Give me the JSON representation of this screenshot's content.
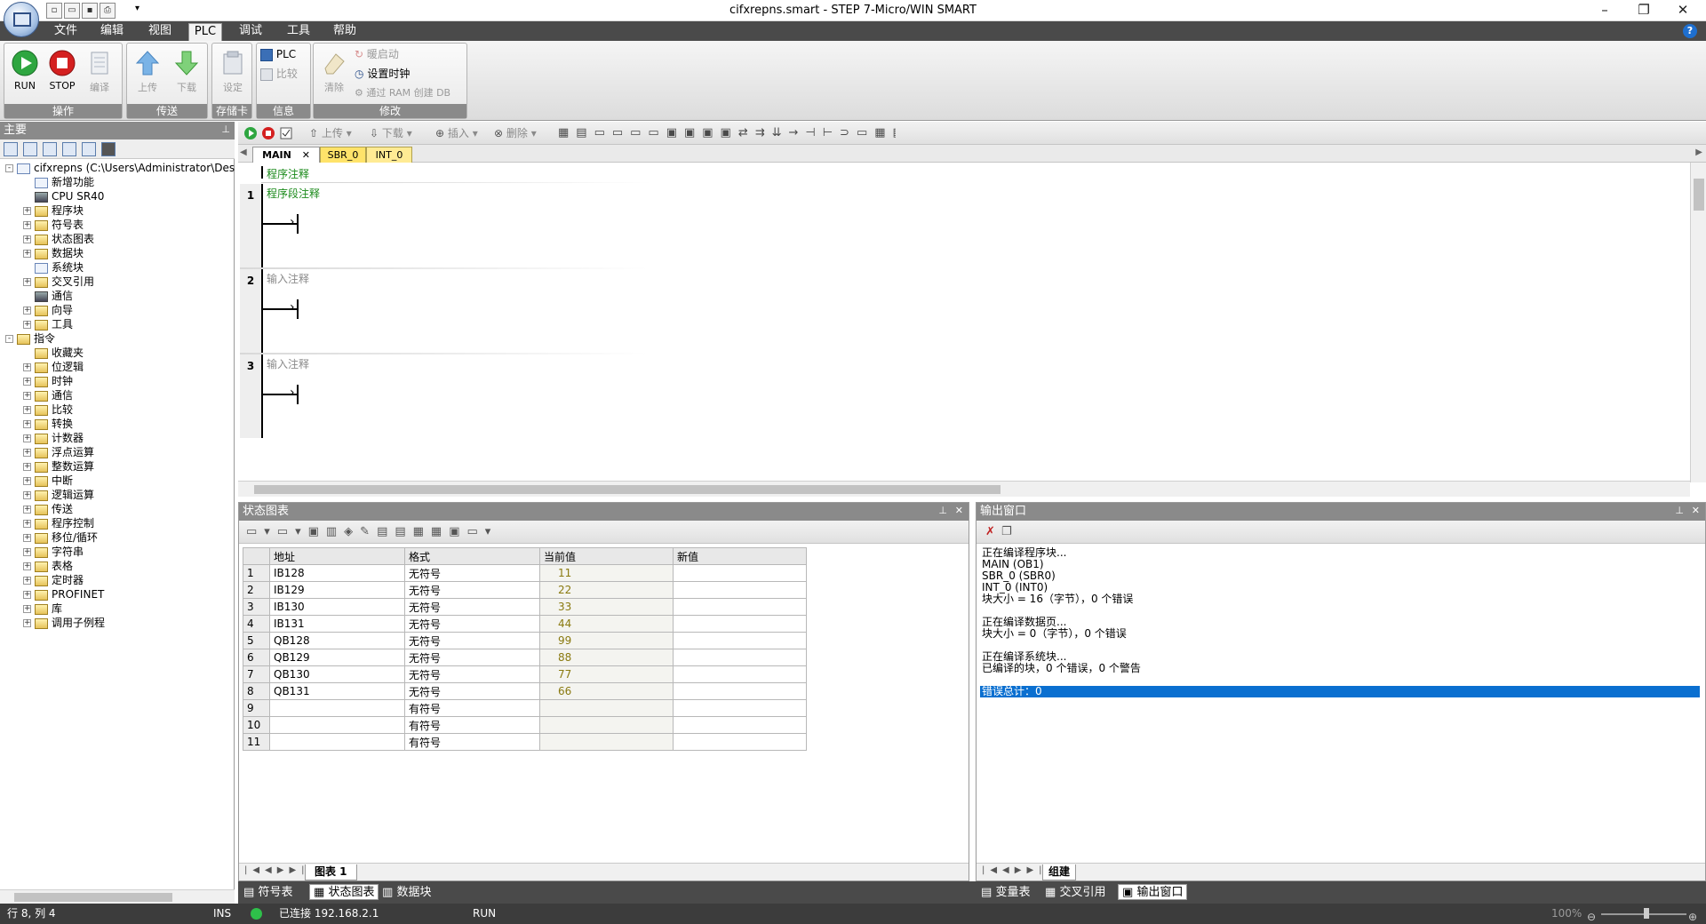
{
  "window": {
    "title": "cifxrepns.smart - STEP 7-Micro/WIN SMART"
  },
  "ribbon_tabs": [
    "文件",
    "编辑",
    "视图",
    "PLC",
    "调试",
    "工具",
    "帮助"
  ],
  "ribbon": {
    "groups": [
      "操作",
      "传送",
      "存储卡",
      "信息",
      "修改"
    ],
    "run": "RUN",
    "stop": "STOP",
    "compile": "编译",
    "upload": "上传",
    "download": "下载",
    "setup": "设定",
    "plc_info": "PLC",
    "compare": "比较",
    "clear": "清除",
    "warm_start": "暖启动",
    "set_clock": "设置时钟",
    "ram_db": "通过 RAM 创建 DB"
  },
  "left_panel": {
    "title": "主要",
    "tree": [
      {
        "label": "cifxrepns (C:\\Users\\Administrator\\Desktop\\hor",
        "level": 0,
        "exp": "-",
        "icon": "project-icon"
      },
      {
        "label": "新增功能",
        "level": 1,
        "exp": "",
        "icon": "new-features-icon"
      },
      {
        "label": "CPU SR40",
        "level": 1,
        "exp": "",
        "icon": "cpu-icon"
      },
      {
        "label": "程序块",
        "level": 1,
        "exp": "+",
        "icon": "folder-icon"
      },
      {
        "label": "符号表",
        "level": 1,
        "exp": "+",
        "icon": "folder-icon"
      },
      {
        "label": "状态图表",
        "level": 1,
        "exp": "+",
        "icon": "folder-icon"
      },
      {
        "label": "数据块",
        "level": 1,
        "exp": "+",
        "icon": "folder-icon"
      },
      {
        "label": "系统块",
        "level": 1,
        "exp": "",
        "icon": "system-block-icon"
      },
      {
        "label": "交叉引用",
        "level": 1,
        "exp": "+",
        "icon": "folder-icon"
      },
      {
        "label": "通信",
        "level": 1,
        "exp": "",
        "icon": "communication-icon"
      },
      {
        "label": "向导",
        "level": 1,
        "exp": "+",
        "icon": "wizard-icon"
      },
      {
        "label": "工具",
        "level": 1,
        "exp": "+",
        "icon": "tools-icon"
      },
      {
        "label": "指令",
        "level": 0,
        "exp": "-",
        "icon": "folder-icon"
      },
      {
        "label": "收藏夹",
        "level": 1,
        "exp": "",
        "icon": "favorites-icon"
      },
      {
        "label": "位逻辑",
        "level": 1,
        "exp": "+",
        "icon": "folder-icon"
      },
      {
        "label": "时钟",
        "level": 1,
        "exp": "+",
        "icon": "folder-icon"
      },
      {
        "label": "通信",
        "level": 1,
        "exp": "+",
        "icon": "folder-icon"
      },
      {
        "label": "比较",
        "level": 1,
        "exp": "+",
        "icon": "folder-icon"
      },
      {
        "label": "转换",
        "level": 1,
        "exp": "+",
        "icon": "folder-icon"
      },
      {
        "label": "计数器",
        "level": 1,
        "exp": "+",
        "icon": "folder-icon"
      },
      {
        "label": "浮点运算",
        "level": 1,
        "exp": "+",
        "icon": "folder-icon"
      },
      {
        "label": "整数运算",
        "level": 1,
        "exp": "+",
        "icon": "folder-icon"
      },
      {
        "label": "中断",
        "level": 1,
        "exp": "+",
        "icon": "folder-icon"
      },
      {
        "label": "逻辑运算",
        "level": 1,
        "exp": "+",
        "icon": "folder-icon"
      },
      {
        "label": "传送",
        "level": 1,
        "exp": "+",
        "icon": "folder-icon"
      },
      {
        "label": "程序控制",
        "level": 1,
        "exp": "+",
        "icon": "folder-icon"
      },
      {
        "label": "移位/循环",
        "level": 1,
        "exp": "+",
        "icon": "folder-icon"
      },
      {
        "label": "字符串",
        "level": 1,
        "exp": "+",
        "icon": "folder-icon"
      },
      {
        "label": "表格",
        "level": 1,
        "exp": "+",
        "icon": "folder-icon"
      },
      {
        "label": "定时器",
        "level": 1,
        "exp": "+",
        "icon": "folder-icon"
      },
      {
        "label": "PROFINET",
        "level": 1,
        "exp": "+",
        "icon": "folder-icon"
      },
      {
        "label": "库",
        "level": 1,
        "exp": "+",
        "icon": "folder-icon"
      },
      {
        "label": "调用子例程",
        "level": 1,
        "exp": "+",
        "icon": "folder-icon"
      }
    ]
  },
  "editor": {
    "toolbar": {
      "upload": "上传",
      "download": "下载",
      "insert": "插入",
      "delete": "删除"
    },
    "tabs": [
      "MAIN",
      "SBR_0",
      "INT_0"
    ],
    "program_comment": "程序注释",
    "rungs": [
      {
        "num": "1",
        "comment": "程序段注释",
        "placeholder": false
      },
      {
        "num": "2",
        "comment": "输入注释",
        "placeholder": true
      },
      {
        "num": "3",
        "comment": "输入注释",
        "placeholder": true
      }
    ]
  },
  "status_chart": {
    "title": "状态图表",
    "columns": [
      "地址",
      "格式",
      "当前值",
      "新值"
    ],
    "rows": [
      {
        "n": "1",
        "addr": "IB128",
        "fmt": "无符号",
        "cur": "11",
        "new": ""
      },
      {
        "n": "2",
        "addr": "IB129",
        "fmt": "无符号",
        "cur": "22",
        "new": ""
      },
      {
        "n": "3",
        "addr": "IB130",
        "fmt": "无符号",
        "cur": "33",
        "new": ""
      },
      {
        "n": "4",
        "addr": "IB131",
        "fmt": "无符号",
        "cur": "44",
        "new": ""
      },
      {
        "n": "5",
        "addr": "QB128",
        "fmt": "无符号",
        "cur": "99",
        "new": ""
      },
      {
        "n": "6",
        "addr": "QB129",
        "fmt": "无符号",
        "cur": "88",
        "new": ""
      },
      {
        "n": "7",
        "addr": "QB130",
        "fmt": "无符号",
        "cur": "77",
        "new": ""
      },
      {
        "n": "8",
        "addr": "QB131",
        "fmt": "无符号",
        "cur": "66",
        "new": ""
      },
      {
        "n": "9",
        "addr": "",
        "fmt": "有符号",
        "cur": "",
        "new": ""
      },
      {
        "n": "10",
        "addr": "",
        "fmt": "有符号",
        "cur": "",
        "new": ""
      },
      {
        "n": "11",
        "addr": "",
        "fmt": "有符号",
        "cur": "",
        "new": ""
      }
    ],
    "sheet_tab": "图表 1"
  },
  "output_window": {
    "title": "输出窗口",
    "lines": [
      "正在编译程序块...",
      "MAIN (OB1)",
      "SBR_0 (SBR0)",
      "INT_0 (INT0)",
      "块大小 = 16（字节），0 个错误",
      "",
      "正在编译数据页...",
      "块大小 = 0（字节），0 个错误",
      "",
      "正在编译系统块...",
      "已编译的块，0 个错误，0 个警告",
      ""
    ],
    "highlight": "错误总计：0",
    "sheet_tab": "组建"
  },
  "bottom_tabs_left": [
    "符号表",
    "状态图表",
    "数据块"
  ],
  "bottom_tabs_right": [
    "变量表",
    "交叉引用",
    "输出窗口"
  ],
  "statusbar": {
    "position": "行 8, 列 4",
    "mode": "INS",
    "connection": "已连接 192.168.2.1",
    "run_state": "RUN",
    "zoom": "100%"
  },
  "colors": {
    "accent_blue": "#0a6fd0",
    "ribbon_caption": "#8a8a8a",
    "comment_green": "#1a8a1a",
    "current_value": "#8a7a10",
    "connected_green": "#2ec04a"
  }
}
